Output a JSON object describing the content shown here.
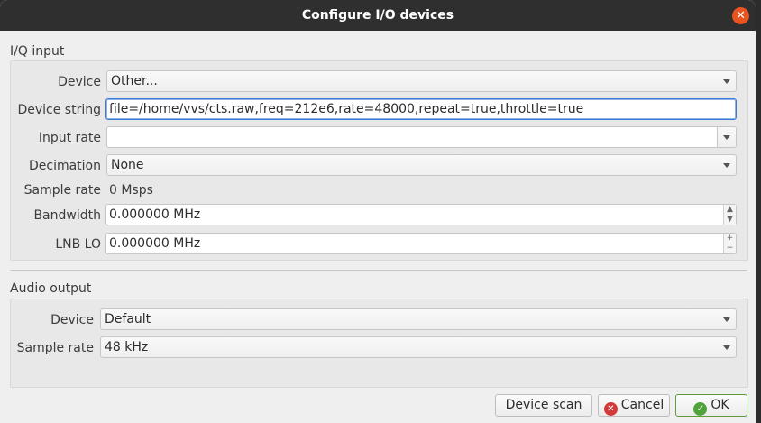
{
  "window": {
    "title": "Configure I/O devices"
  },
  "iq_input": {
    "section_title": "I/Q input",
    "device_label": "Device",
    "device_value": "Other...",
    "device_string_label": "Device string",
    "device_string_value": "file=/home/vvs/cts.raw,freq=212e6,rate=48000,repeat=true,throttle=true",
    "input_rate_label": "Input rate",
    "input_rate_value": "",
    "decimation_label": "Decimation",
    "decimation_value": "None",
    "sample_rate_label": "Sample rate",
    "sample_rate_value": "0 Msps",
    "bandwidth_label": "Bandwidth",
    "bandwidth_value": "0.000000 MHz",
    "lnb_lo_label": "LNB LO",
    "lnb_lo_value": "0.000000 MHz"
  },
  "audio_output": {
    "section_title": "Audio output",
    "device_label": "Device",
    "device_value": "Default",
    "sample_rate_label": "Sample rate",
    "sample_rate_value": "48 kHz"
  },
  "buttons": {
    "device_scan": "Device scan",
    "cancel": "Cancel",
    "ok": "OK"
  },
  "icons": {
    "close": "close-icon",
    "dropdown": "chevron-down-icon",
    "cancel": "cancel-icon",
    "ok": "checkmark-icon"
  },
  "colors": {
    "titlebar": "#2f2f2f",
    "close_accent": "#e95420",
    "focus": "#3a7bd5",
    "cancel_icon": "#d23a3a",
    "ok_icon": "#4ea33a"
  }
}
